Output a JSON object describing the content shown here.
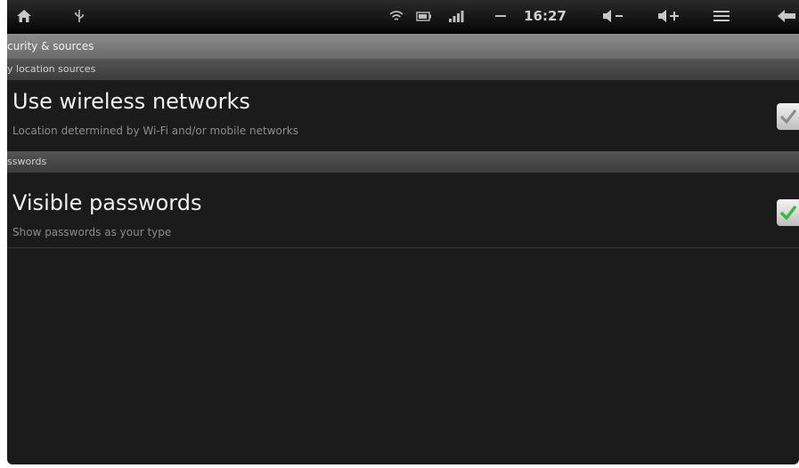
{
  "status_bar": {
    "time": "16:27",
    "home_icon": "home-icon",
    "usb_icon": "usb-icon",
    "wifi_icon": "wifi-icon",
    "signal_icon": "signal-icon",
    "battery_icon": "battery-icon",
    "volume_down_icon": "volume-down-icon",
    "volume_up_icon": "volume-up-icon",
    "menu_icon": "menu-icon",
    "back_icon": "back-arrow-icon"
  },
  "title_bar": {
    "title": "curity & sources"
  },
  "sections": {
    "location_header": "y location sources",
    "passwords_header": "sswords"
  },
  "prefs": {
    "wireless": {
      "title": "Use wireless networks",
      "summary": "Location determined by Wi-Fi and/or mobile networks",
      "checked": true,
      "check_color": "#9a9a9a"
    },
    "passwords": {
      "title": "Visible passwords",
      "summary": "Show passwords as your type",
      "checked": true,
      "check_color": "#3cb83c"
    }
  },
  "colors": {
    "background": "#1b1b1b",
    "title_bar": "#7a7a7a",
    "category": "#4a4a4a"
  }
}
